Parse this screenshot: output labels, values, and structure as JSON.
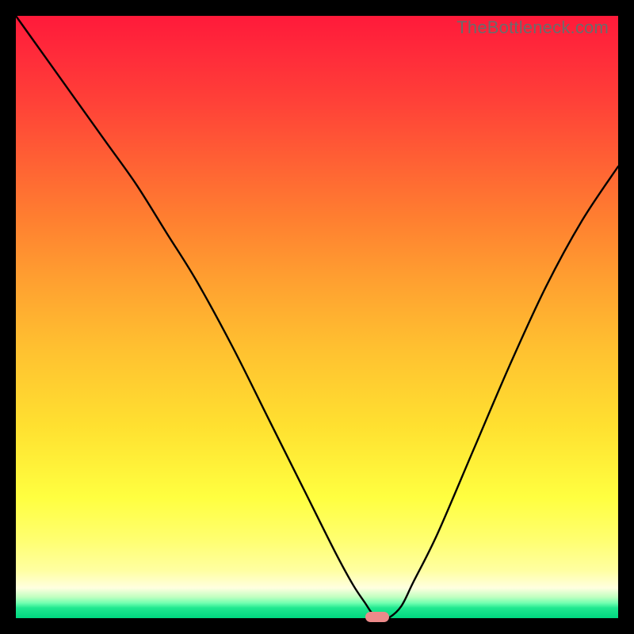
{
  "watermark": "TheBottleneck.com",
  "colors": {
    "frame": "#000000",
    "curve": "#000000",
    "marker": "#ec8a8a"
  },
  "chart_data": {
    "type": "line",
    "title": "",
    "xlabel": "",
    "ylabel": "",
    "xlim": [
      0,
      100
    ],
    "ylim": [
      0,
      100
    ],
    "grid": false,
    "legend": false,
    "x": [
      0,
      5,
      10,
      15,
      20,
      25,
      30,
      36,
      42,
      48,
      53,
      56,
      58,
      59,
      60,
      61,
      62,
      64,
      66,
      70,
      76,
      82,
      88,
      94,
      100
    ],
    "y": [
      100,
      93,
      86,
      79,
      72,
      64,
      56,
      45,
      33,
      21,
      11,
      5.5,
      2.5,
      1,
      0.1,
      0.1,
      0.1,
      2,
      6,
      14,
      28,
      42,
      55,
      66,
      75
    ],
    "marker": {
      "x": 60,
      "y": 0
    },
    "notes": "V-shaped bottleneck curve; minimum (optimal balance) near x≈60 at the green band (y≈0). Colors: red=high bottleneck, green=low bottleneck."
  }
}
